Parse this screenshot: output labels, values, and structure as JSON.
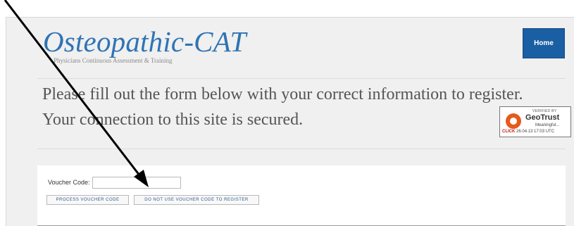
{
  "header": {
    "logo_title": "Osteopathic-CAT",
    "logo_tagline": "Physicians Continuous Assessment & Training",
    "home_label": "Home"
  },
  "intro": {
    "line1": "Please fill out the form below with your correct information to register.",
    "line2": "Your connection to this site is secured."
  },
  "security_badge": {
    "verified_by": "VERIFIED BY",
    "brand": "GeoTrust",
    "meaningful": "Meaningful...",
    "click_label": "CLICK",
    "timestamp": "26.04.13 17:03 UTC"
  },
  "form": {
    "voucher_label": "Voucher Code:",
    "voucher_value": "",
    "process_button_label": "PROCESS VOUCHER CODE",
    "no_voucher_button_label": "DO NOT USE VOUCHER CODE TO REGISTER"
  },
  "colors": {
    "brand_blue": "#2f74b4",
    "home_button": "#1a5ea3",
    "annotation_arrow": "#000000"
  },
  "icons": [
    "geotrust-logo-icon",
    "annotation-arrow"
  ]
}
